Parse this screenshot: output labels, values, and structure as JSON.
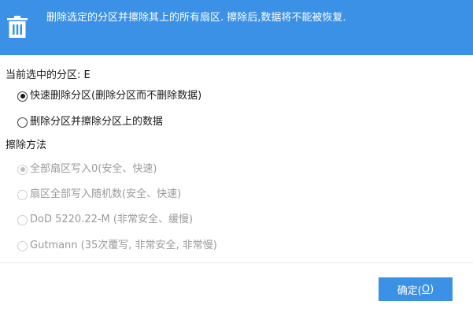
{
  "header": {
    "icon": "trash-icon",
    "message": "删除选定的分区并擦除其上的所有扇区. 擦除后,数据将不能被恢复."
  },
  "selected_partition": {
    "label": "当前选中的分区:",
    "value": "E"
  },
  "delete_options": [
    {
      "label": "快速删除分区(删除分区而不删除数据)",
      "checked": true
    },
    {
      "label": "删除分区并擦除分区上的数据",
      "checked": false
    }
  ],
  "wipe_method": {
    "title": "擦除方法",
    "options": [
      {
        "label": "全部扇区写入0(安全、快速)",
        "checked": true,
        "enabled": false
      },
      {
        "label": "扇区全部写入随机数(安全、快速)",
        "checked": false,
        "enabled": false
      },
      {
        "label": "DoD 5220.22-M (非常安全、缓慢)",
        "checked": false,
        "enabled": false
      },
      {
        "label": "Gutmann (35次覆写, 非常安全, 非常慢)",
        "checked": false,
        "enabled": false
      }
    ]
  },
  "footer": {
    "ok_label": "确定(",
    "ok_hotkey": "O",
    "ok_suffix": ")"
  },
  "colors": {
    "accent": "#3b91e6",
    "disabled_text": "#9a9a9a"
  }
}
